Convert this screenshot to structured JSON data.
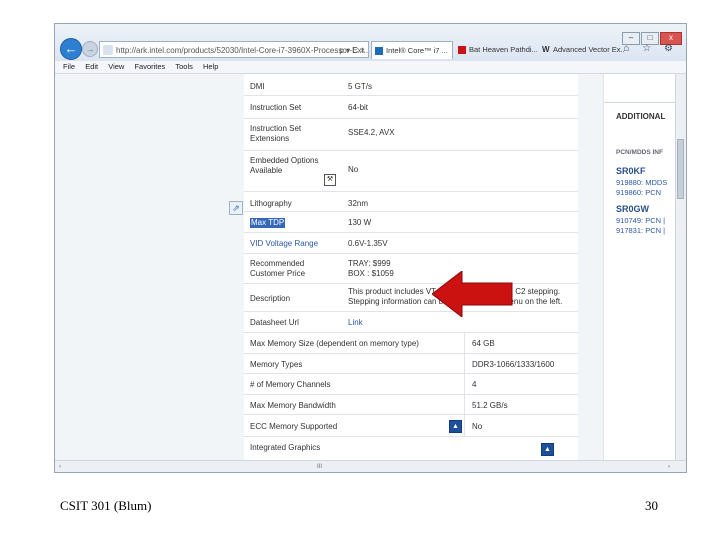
{
  "browser": {
    "address": "http://ark.intel.com/products/52030/Intel-Core-i7-3960X-Processor-Ext...",
    "address_controls": "ρ ▾ C ×",
    "tabs": [
      {
        "label": "Intel® Core™ i7 ...",
        "active": true
      },
      {
        "label": "Bat Heaven Pathdi...",
        "active": false
      },
      {
        "label": "Advanced Vector Ex...",
        "active": false
      }
    ],
    "window_buttons": {
      "minimize": "–",
      "maximize": "□",
      "close": "x"
    },
    "right_icons": "⌂ ☆ ⚙"
  },
  "menu": [
    "File",
    "Edit",
    "View",
    "Favorites",
    "Tools",
    "Help"
  ],
  "specs": [
    {
      "label": "DMI",
      "value": "5 GT/s"
    },
    {
      "label": "Instruction Set",
      "value": "64-bit"
    },
    {
      "label": "Instruction Set Extensions",
      "value": "SSE4.2, AVX"
    },
    {
      "label": "Embedded Options Available",
      "value": "No"
    },
    {
      "label": "Lithography",
      "value": "32nm"
    },
    {
      "label": "Max TDP",
      "value": "130 W"
    },
    {
      "label": "VID Voltage Range",
      "value": "0.6V-1.35V"
    },
    {
      "label": "Recommended Customer Price",
      "value": "TRAY: $999\nBOX : $1059"
    },
    {
      "label": "Description",
      "value": "This product includes VT-d support only on the C2 stepping.\nStepping information can be viewed via the menu on the left."
    },
    {
      "label": "Datasheet Url",
      "value": "Link"
    }
  ],
  "memory": [
    {
      "label": "Max Memory Size (dependent on memory type)",
      "value": "64 GB"
    },
    {
      "label": "Memory Types",
      "value": "DDR3-1066/1333/1600"
    },
    {
      "label": "# of Memory Channels",
      "value": "4"
    },
    {
      "label": "Max Memory Bandwidth",
      "value": "51.2 GB/s"
    },
    {
      "label": "ECC Memory Supported",
      "value": "No"
    },
    {
      "label": "Integrated Graphics",
      "value": ""
    }
  ],
  "right_panel": {
    "title": "ADDITIONAL",
    "subtitle": "PCN/MDDS INF",
    "codes": [
      {
        "code": "SR0KF",
        "lines": [
          "919880: MDDS",
          "919860: PCN"
        ]
      },
      {
        "code": "SR0GW",
        "lines": [
          "910749: PCN |",
          "917831: PCN |"
        ]
      }
    ]
  },
  "scrollbar": {
    "left": "‹",
    "mid": "III",
    "right": "›"
  },
  "colors": {
    "selection": "#3568b8",
    "arrow": "#cc1111",
    "link": "#2b5aa3"
  },
  "footer": {
    "left": "CSIT 301 (Blum)",
    "right": "30"
  }
}
